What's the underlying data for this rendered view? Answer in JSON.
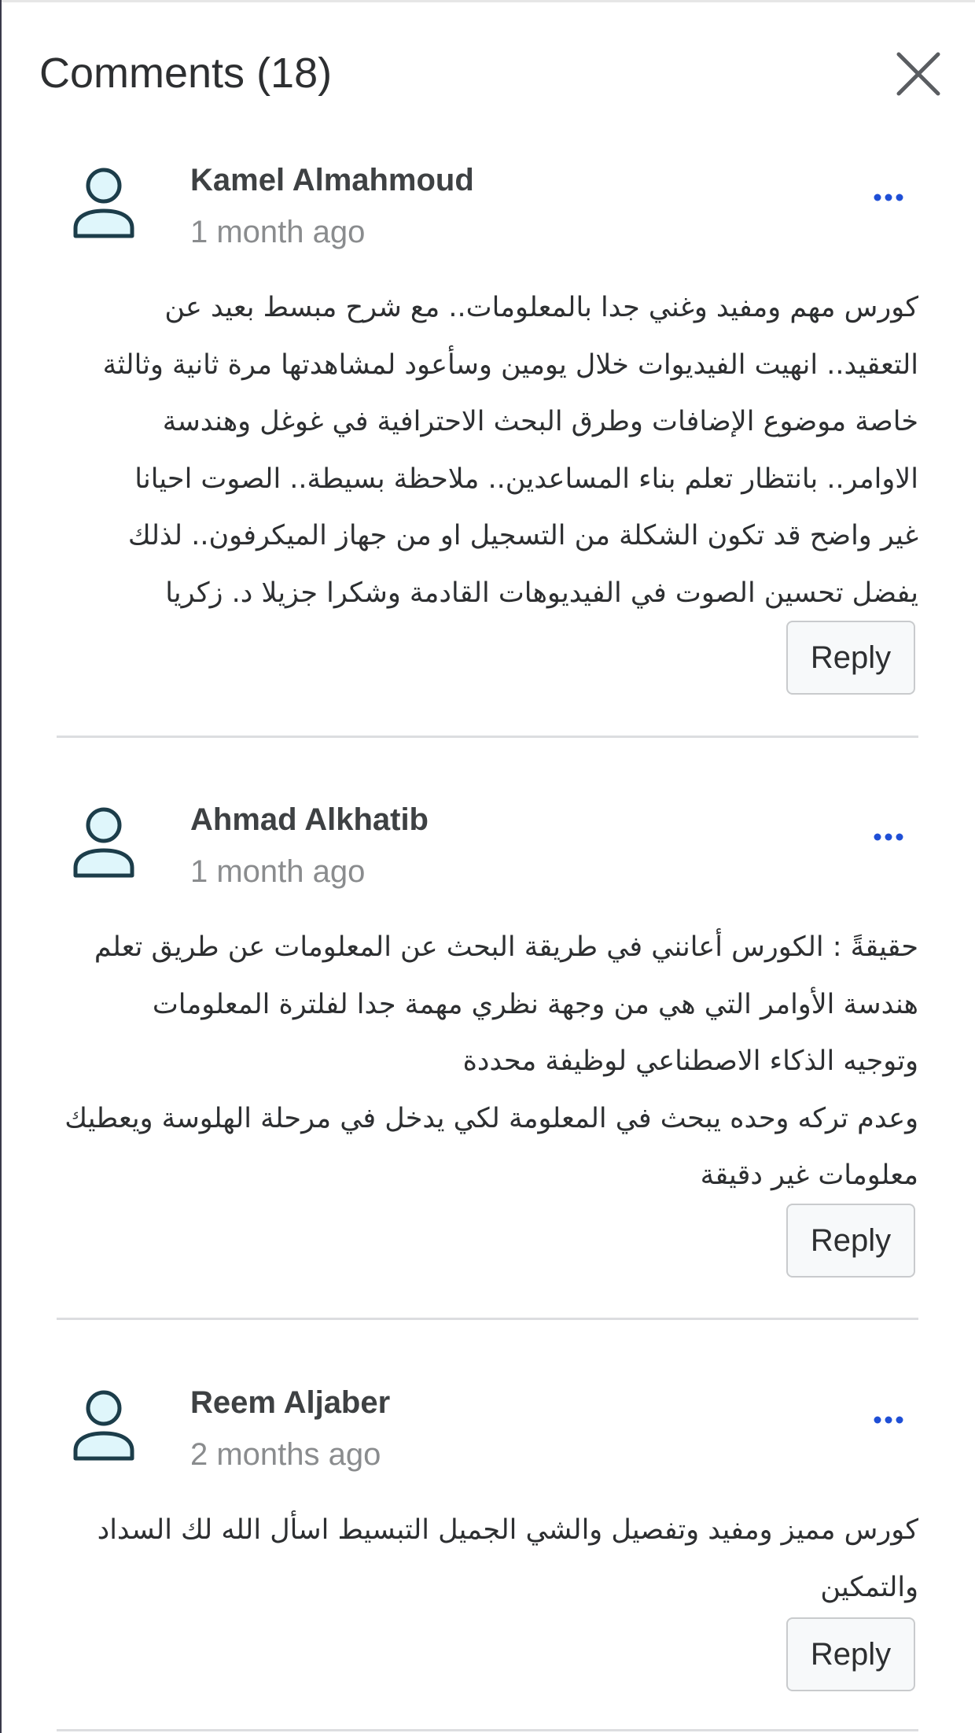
{
  "header": {
    "title": "Comments (18)"
  },
  "icons": {
    "close": "close-icon",
    "avatar": "user-avatar-icon",
    "more": "more-options-icon"
  },
  "colors": {
    "avatar_stroke": "#1c3d4a",
    "avatar_fill": "#dff6fb",
    "more_dots": "#1f4fd6",
    "divider": "#dcdde0"
  },
  "comments": [
    {
      "author": "Kamel Almahmoud",
      "time": "1 month ago",
      "body": "كورس مهم ومفيد وغني جدا بالمعلومات.. مع شرح مبسط بعيد عن\nالتعقيد.. انهيت الفيديوات خلال يومين وسأعود لمشاهدتها مرة ثانية وثالثة\nخاصة موضوع الإضافات وطرق البحث الاحترافية في غوغل وهندسة\nالاوامر.. بانتظار تعلم بناء المساعدين.. ملاحظة بسيطة.. الصوت احيانا\nغير واضح قد تكون الشكلة من التسجيل او من جهاز الميكرفون.. لذلك\nيفضل تحسين الصوت في الفيديوهات القادمة وشكرا جزيلا د. زكريا",
      "reply_label": "Reply"
    },
    {
      "author": "Ahmad Alkhatib",
      "time": "1 month ago",
      "body": "حقيقةً : الكورس أعانني في طريقة البحث عن المعلومات عن طريق تعلم\nهندسة الأوامر التي هي من وجهة نظري مهمة جدا لفلترة المعلومات\nوتوجيه الذكاء الاصطناعي لوظيفة محددة\nوعدم تركه وحده يبحث في المعلومة لكي يدخل في مرحلة الهلوسة ويعطيك\nمعلومات غير دقيقة",
      "reply_label": "Reply"
    },
    {
      "author": "Reem Aljaber",
      "time": "2 months ago",
      "body": "كورس مميز ومفيد وتفصيل والشي الجميل التبسيط اسأل الله لك السداد\nوالتمكين",
      "reply_label": "Reply"
    }
  ]
}
